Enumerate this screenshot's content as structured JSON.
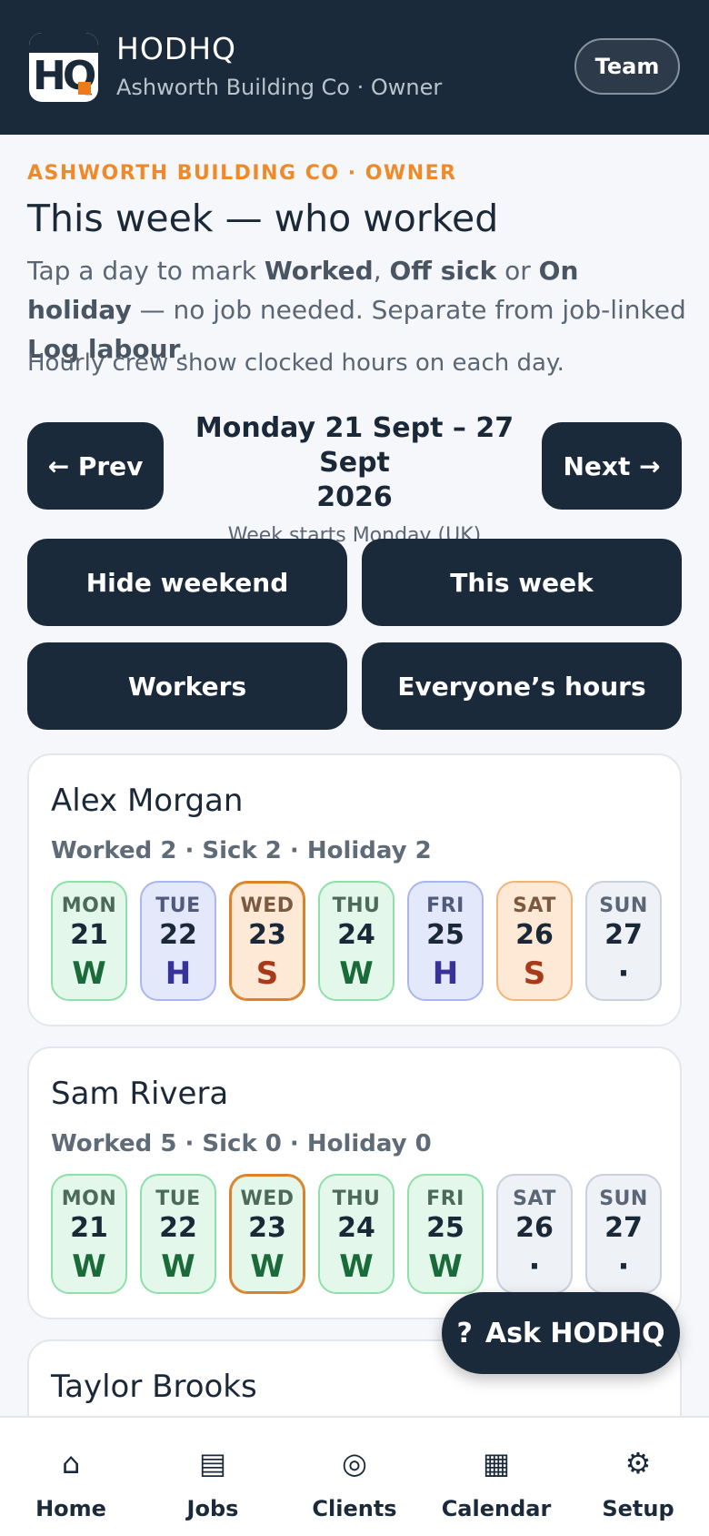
{
  "header": {
    "logo_text": "HQ",
    "app_name": "HODHQ",
    "subtitle": "Ashworth Building Co · Owner",
    "team_label": "Team"
  },
  "page": {
    "eyebrow": "ASHWORTH BUILDING CO · OWNER",
    "title": "This week — who worked",
    "intro": {
      "t1": "Tap a day to mark ",
      "worked": "Worked",
      "t2": ", ",
      "sick": "Off sick",
      "t3": " or ",
      "holiday": "On holiday",
      "t4": " — no job needed. Separate from job-linked ",
      "log": "Log labour",
      "t5": "."
    },
    "note": "Hourly crew show clocked hours on each day."
  },
  "week_nav": {
    "prev_label": "← Prev",
    "next_label": "Next →",
    "range_line1": "Monday 21 Sept – 27 Sept",
    "range_line2": "2026",
    "hint": "Week starts Monday (UK)"
  },
  "actions": {
    "hide_weekend": "Hide weekend",
    "this_week": "This week",
    "workers": "Workers",
    "everyones_hours": "Everyone’s hours"
  },
  "workers": [
    {
      "name": "Alex Morgan",
      "stats": "Worked 2 · Sick 2 · Holiday 2",
      "days": [
        {
          "day": "MON",
          "date": "21",
          "mark": "W"
        },
        {
          "day": "TUE",
          "date": "22",
          "mark": "H"
        },
        {
          "day": "WED",
          "date": "23",
          "mark": "S"
        },
        {
          "day": "THU",
          "date": "24",
          "mark": "W"
        },
        {
          "day": "FRI",
          "date": "25",
          "mark": "H"
        },
        {
          "day": "SAT",
          "date": "26",
          "mark": "S"
        },
        {
          "day": "SUN",
          "date": "27",
          "mark": "·"
        }
      ]
    },
    {
      "name": "Sam Rivera",
      "stats": "Worked 5 · Sick 0 · Holiday 0",
      "days": [
        {
          "day": "MON",
          "date": "21",
          "mark": "W"
        },
        {
          "day": "TUE",
          "date": "22",
          "mark": "W"
        },
        {
          "day": "WED",
          "date": "23",
          "mark": "W"
        },
        {
          "day": "THU",
          "date": "24",
          "mark": "W"
        },
        {
          "day": "FRI",
          "date": "25",
          "mark": "W"
        },
        {
          "day": "SAT",
          "date": "26",
          "mark": "·"
        },
        {
          "day": "SUN",
          "date": "27",
          "mark": "·"
        }
      ]
    },
    {
      "name": "Taylor Brooks"
    }
  ],
  "assistant": {
    "icon": "?",
    "label": "Ask HODHQ"
  },
  "nav": [
    {
      "label": "Home",
      "icon": "⌂",
      "icon_name": "home-icon"
    },
    {
      "label": "Jobs",
      "icon": "▤",
      "icon_name": "jobs-icon"
    },
    {
      "label": "Clients",
      "icon": "◎",
      "icon_name": "clients-icon"
    },
    {
      "label": "Calendar",
      "icon": "▦",
      "icon_name": "calendar-icon"
    },
    {
      "label": "Setup",
      "icon": "⚙",
      "icon_name": "gear-icon"
    }
  ],
  "colors": {
    "brand_dark": "#1b2a3a",
    "accent_orange": "#ee8a2a",
    "worked_green": "#1b6a3a",
    "holiday_blue": "#36329a",
    "sick_red": "#a8391a"
  }
}
